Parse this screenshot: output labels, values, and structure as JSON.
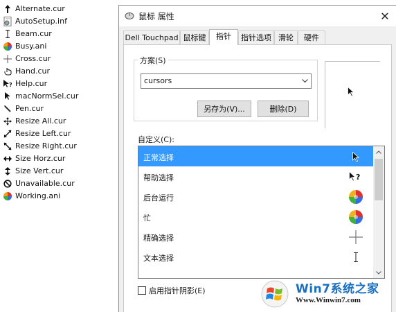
{
  "file_list": [
    {
      "name": "Alternate.cur",
      "icon": "arrow-up-icon"
    },
    {
      "name": "AutoSetup.inf",
      "icon": "settings-file-icon"
    },
    {
      "name": "Beam.cur",
      "icon": "text-beam-icon"
    },
    {
      "name": "Busy.ani",
      "icon": "busy-wheel-icon"
    },
    {
      "name": "Cross.cur",
      "icon": "crosshair-icon"
    },
    {
      "name": "Hand.cur",
      "icon": "hand-icon"
    },
    {
      "name": "Help.cur",
      "icon": "help-cursor-icon"
    },
    {
      "name": "macNormSel.cur",
      "icon": "arrow-pointer-icon"
    },
    {
      "name": "Pen.cur",
      "icon": "pen-icon"
    },
    {
      "name": "Resize All.cur",
      "icon": "move-icon"
    },
    {
      "name": "Resize Left.cur",
      "icon": "resize-diagonal-icon"
    },
    {
      "name": "Resize Right.cur",
      "icon": "resize-diagonal-icon"
    },
    {
      "name": "Size Horz.cur",
      "icon": "resize-horizontal-icon"
    },
    {
      "name": "Size Vert.cur",
      "icon": "resize-vertical-icon"
    },
    {
      "name": "Unavailable.cur",
      "icon": "unavailable-icon"
    },
    {
      "name": "Working.ani",
      "icon": "busy-wheel-icon"
    }
  ],
  "dialog": {
    "title": "鼠标 属性",
    "close_label": "✕",
    "tabs": [
      {
        "label": "Dell Touchpad",
        "active": false
      },
      {
        "label": "鼠标键",
        "active": false
      },
      {
        "label": "指针",
        "active": true
      },
      {
        "label": "指针选项",
        "active": false
      },
      {
        "label": "滑轮",
        "active": false
      },
      {
        "label": "硬件",
        "active": false
      }
    ],
    "scheme": {
      "label": "方案(S)",
      "value": "cursors",
      "save_as_label": "另存为(V)...",
      "delete_label": "删除(D)"
    },
    "customize": {
      "label": "自定义(C):",
      "items": [
        {
          "label": "正常选择",
          "icon": "arrow-pointer-icon",
          "selected": true
        },
        {
          "label": "帮助选择",
          "icon": "help-cursor-icon",
          "selected": false
        },
        {
          "label": "后台运行",
          "icon": "busy-wheel-icon",
          "selected": false
        },
        {
          "label": "忙",
          "icon": "busy-wheel-icon",
          "selected": false
        },
        {
          "label": "精确选择",
          "icon": "crosshair-icon",
          "selected": false
        },
        {
          "label": "文本选择",
          "icon": "text-beam-icon",
          "selected": false
        }
      ]
    },
    "shadow_checkbox": {
      "label": "启用指针阴影(E)",
      "checked": false
    }
  },
  "watermark": {
    "title": "Win7系统之家",
    "url": "Www.Winwin7.com"
  },
  "colors": {
    "selection": "#3399ff",
    "watermark_blue": "#1a6fc0"
  }
}
